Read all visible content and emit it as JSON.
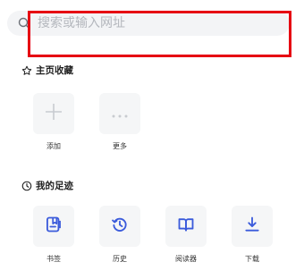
{
  "search": {
    "placeholder": "搜索或输入网址",
    "value": ""
  },
  "sections": {
    "home": {
      "title": "主页收藏",
      "icon": "star-outline-icon",
      "items": [
        {
          "label": "添加",
          "icon": "plus-icon"
        },
        {
          "label": "更多",
          "icon": "more-dots-icon"
        }
      ]
    },
    "footprints": {
      "title": "我的足迹",
      "icon": "clock-icon",
      "items": [
        {
          "label": "书签",
          "icon": "bookmark-icon"
        },
        {
          "label": "历史",
          "icon": "history-icon"
        },
        {
          "label": "阅读器",
          "icon": "book-icon"
        },
        {
          "label": "下载",
          "icon": "download-icon"
        }
      ]
    }
  },
  "colors": {
    "accent": "#3b5bdb",
    "highlight_border": "#e60012",
    "tile_bg": "#f5f6f7",
    "search_bg": "#f3f4f6"
  }
}
